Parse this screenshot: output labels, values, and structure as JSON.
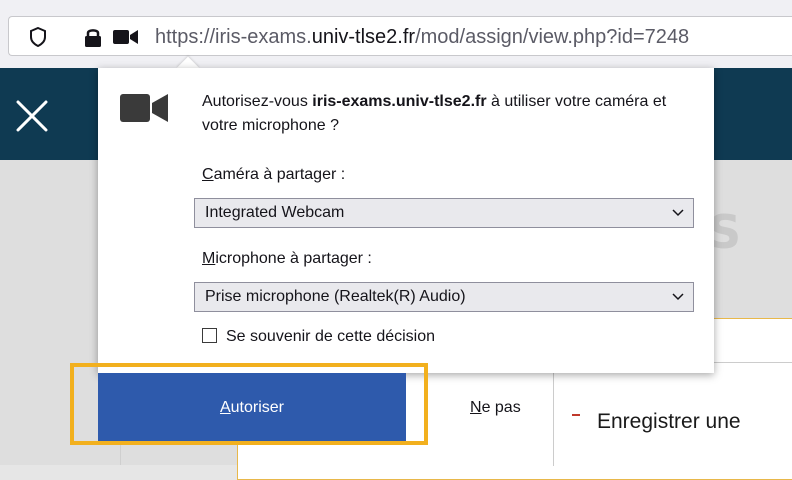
{
  "urlbar": {
    "url_prefix": "https://iris-exams.",
    "url_domain": "univ-tlse2.fr",
    "url_path": "/mod/assign/view.php?id=7248"
  },
  "permission": {
    "message_pre": "Autorisez-vous ",
    "message_domain": "iris-exams.univ-tlse2.fr",
    "message_post": " à utiliser votre caméra et votre microphone ?",
    "camera_label_first": "C",
    "camera_label_rest": "améra à partager :",
    "camera_value": "Integrated Webcam",
    "mic_label_first": "M",
    "mic_label_rest": "icrophone à partager :",
    "mic_value": "Prise microphone (Realtek(R) Audio)",
    "remember_label": "Se souvenir de cette décision",
    "allow_first": "A",
    "allow_rest": "utoriser",
    "deny_first": "N",
    "deny_rest": "e pas"
  },
  "page": {
    "record_text": "Enregistrer une"
  },
  "colors": {
    "header": "#0f3a52",
    "allow_button": "#2e5aac",
    "highlight": "#f2b01e"
  }
}
